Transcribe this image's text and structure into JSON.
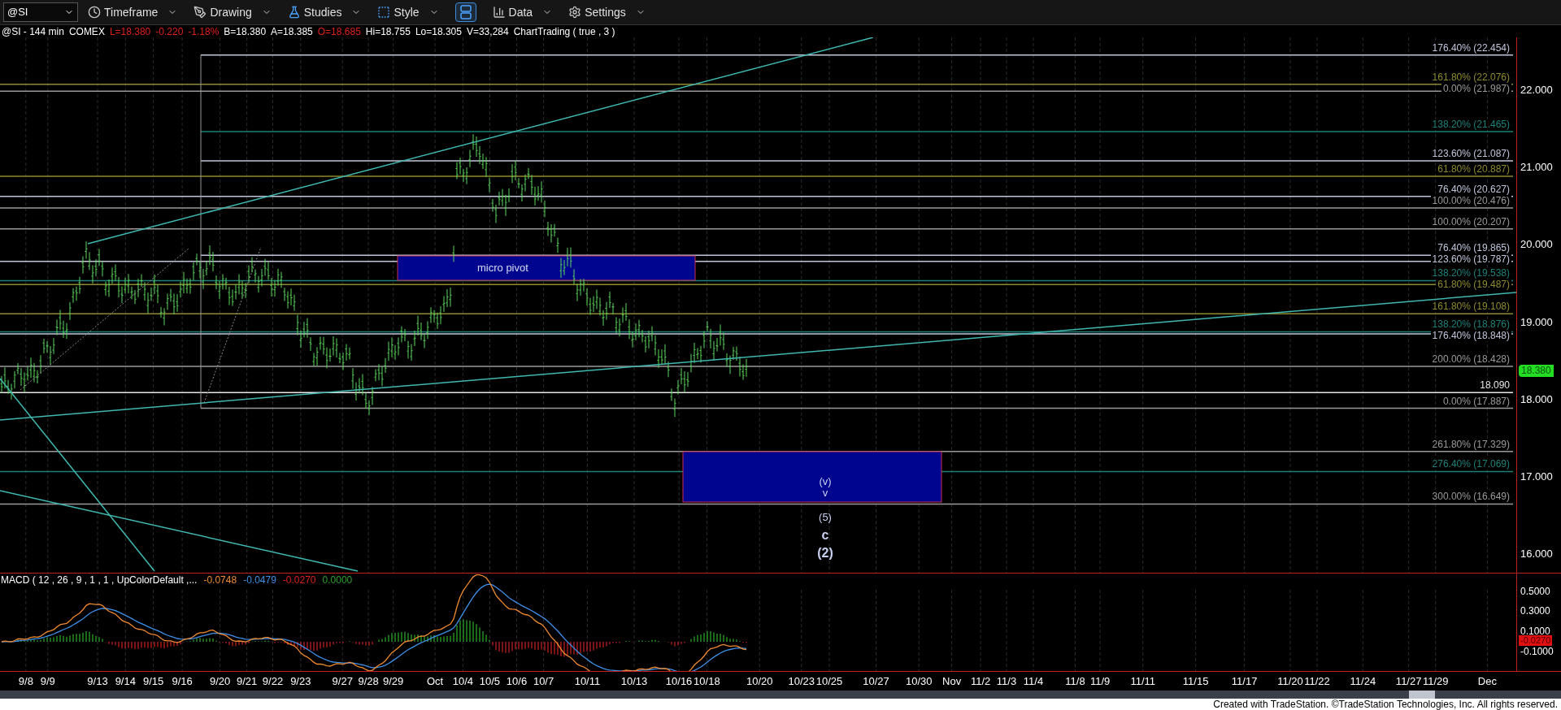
{
  "toolbar": {
    "symbol": "@SI",
    "items": [
      {
        "kind": "timeframe",
        "label": "Timeframe"
      },
      {
        "kind": "drawing",
        "label": "Drawing"
      },
      {
        "kind": "studies",
        "label": "Studies"
      },
      {
        "kind": "style",
        "label": "Style"
      },
      {
        "kind": "layout",
        "selected": true
      },
      {
        "kind": "data",
        "label": "Data"
      },
      {
        "kind": "settings",
        "label": "Settings"
      }
    ]
  },
  "info_line": [
    {
      "text": "@SI - 144 min",
      "color": "#ffffff"
    },
    {
      "text": "COMEX",
      "color": "#ffffff"
    },
    {
      "text": "L=18.380",
      "color": "#e0201a"
    },
    {
      "text": "-0.220",
      "color": "#e0201a"
    },
    {
      "text": "-1.18%",
      "color": "#e0201a"
    },
    {
      "text": "B=18.380",
      "color": "#ffffff"
    },
    {
      "text": "A=18.385",
      "color": "#ffffff"
    },
    {
      "text": "O=18.685",
      "color": "#e0201a"
    },
    {
      "text": "Hi=18.755",
      "color": "#ffffff"
    },
    {
      "text": "Lo=18.305",
      "color": "#ffffff"
    },
    {
      "text": "V=33,284",
      "color": "#ffffff"
    },
    {
      "text": "ChartTrading ( true , 3 )",
      "color": "#ffffff"
    }
  ],
  "fib_levels": [
    {
      "label": "176.40% (22.454)",
      "color": "#c0c6dc"
    },
    {
      "label": "161.80% (22.076)",
      "color": "#8f8a2e"
    },
    {
      "label": "0.00% (21.987)",
      "color": "#9a9a9a"
    },
    {
      "label": "138.20% (21.465)",
      "color": "#1e8078"
    },
    {
      "label": "123.60% (21.087)",
      "color": "#c0c6dc"
    },
    {
      "label": "61.80% (20.887)",
      "color": "#8f8a2e"
    },
    {
      "label": "76.40% (20.627)",
      "color": "#c0c6dc"
    },
    {
      "label": "100.00% (20.476)",
      "color": "#9a9a9a"
    },
    {
      "label": "100.00% (20.207)",
      "color": "#9a9a9a"
    },
    {
      "label": "76.40% (19.865)",
      "color": "#c0c6dc"
    },
    {
      "label": "123.60% (19.787)",
      "color": "#c0c6dc"
    },
    {
      "label": "138.20% (19.538)",
      "color": "#1e8078"
    },
    {
      "label": "61.80% (19.487)",
      "color": "#8f8a2e"
    },
    {
      "label": "161.80% (19.108)",
      "color": "#8f8a2e"
    },
    {
      "label": "138.20% (18.876)",
      "color": "#1e8078"
    },
    {
      "label": "176.40% (18.848)",
      "color": "#c0c6dc"
    },
    {
      "label": "200.00% (18.428)",
      "color": "#9a9a9a"
    },
    {
      "label": "18.090",
      "color": "#e8e8e8"
    },
    {
      "label": "0.00% (17.887)",
      "color": "#9a9a9a"
    },
    {
      "label": "261.80% (17.329)",
      "color": "#9a9a9a"
    },
    {
      "label": "276.40% (17.069)",
      "color": "#1e8078"
    },
    {
      "label": "300.00% (16.649)",
      "color": "#9a9a9a"
    }
  ],
  "zones": [
    {
      "label": "micro pivot"
    },
    {
      "labels": [
        "(v)",
        "v"
      ]
    }
  ],
  "wave_labels": [
    "(5)",
    "c",
    "(2)"
  ],
  "price_axis": {
    "ticks": [
      "22.000",
      "21.000",
      "20.000",
      "19.000",
      "18.000",
      "17.000",
      "16.000"
    ],
    "last_price": "18.380"
  },
  "macd": {
    "title": "MACD ( 12 , 26 , 9 , 1 , 1 , UpColorDefault ,...",
    "values": [
      {
        "text": "-0.0748",
        "color": "#f08a30"
      },
      {
        "text": "-0.0479",
        "color": "#3d8fe8"
      },
      {
        "text": "-0.0270",
        "color": "#e0201a"
      },
      {
        "text": "0.0000",
        "color": "#2aa02a"
      }
    ],
    "ticks": [
      "0.5000",
      "0.3000",
      "0.1000",
      "-0.1000"
    ],
    "last_value": "-0.0270"
  },
  "date_axis": [
    "9/8",
    "9/9",
    "9/13",
    "9/14",
    "9/15",
    "9/16",
    "9/20",
    "9/21",
    "9/22",
    "9/23",
    "9/27",
    "9/28",
    "9/29",
    "Oct",
    "10/4",
    "10/5",
    "10/6",
    "10/7",
    "10/11",
    "10/13",
    "10/16",
    "10/18",
    "10/20",
    "10/23",
    "10/25",
    "10/27",
    "10/30",
    "Nov",
    "11/2",
    "11/3",
    "11/4",
    "11/8",
    "11/9",
    "11/11",
    "11/15",
    "11/17",
    "11/20",
    "11/22",
    "11/24",
    "11/27",
    "11/29",
    "Dec"
  ],
  "footer": "Created with TradeStation. ©TradeStation Technologies, Inc. All rights reserved."
}
